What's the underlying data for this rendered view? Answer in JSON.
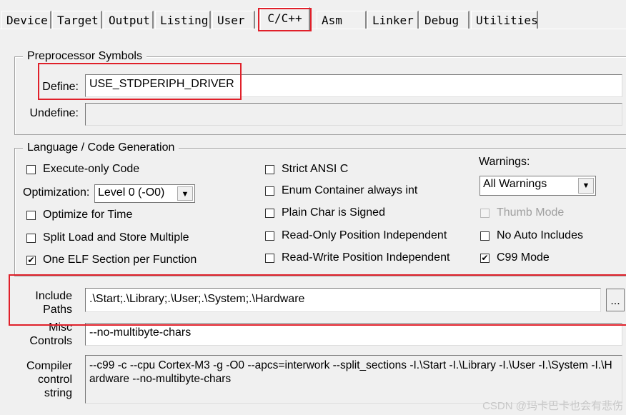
{
  "tabs": [
    {
      "label": "Device"
    },
    {
      "label": "Target"
    },
    {
      "label": "Output"
    },
    {
      "label": "Listing"
    },
    {
      "label": "User"
    },
    {
      "label": "C/C++"
    },
    {
      "label": "Asm"
    },
    {
      "label": "Linker"
    },
    {
      "label": "Debug"
    },
    {
      "label": "Utilities"
    }
  ],
  "active_tab": "C/C++",
  "preprocessor": {
    "title": "Preprocessor Symbols",
    "define_label": "Define:",
    "define_value": "USE_STDPERIPH_DRIVER",
    "undefine_label": "Undefine:",
    "undefine_value": ""
  },
  "language": {
    "title": "Language / Code Generation",
    "execute_only": {
      "label": "Execute-only Code",
      "checked": false
    },
    "optimization_label": "Optimization:",
    "optimization_value": "Level 0 (-O0)",
    "optimize_time": {
      "label": "Optimize for Time",
      "checked": false
    },
    "split_load": {
      "label": "Split Load and Store Multiple",
      "checked": false
    },
    "one_elf": {
      "label": "One ELF Section per Function",
      "checked": true
    },
    "strict_ansi": {
      "label": "Strict ANSI C",
      "checked": false
    },
    "enum_container": {
      "label": "Enum Container always int",
      "checked": false
    },
    "plain_char": {
      "label": "Plain Char is Signed",
      "checked": false
    },
    "ro_pi": {
      "label": "Read-Only Position Independent",
      "checked": false
    },
    "rw_pi": {
      "label": "Read-Write Position Independent",
      "checked": false
    },
    "warnings_label": "Warnings:",
    "warnings_value": "All Warnings",
    "thumb_mode": {
      "label": "Thumb Mode",
      "checked": false,
      "disabled": true
    },
    "no_auto_includes": {
      "label": "No Auto Includes",
      "checked": false
    },
    "c99_mode": {
      "label": "C99 Mode",
      "checked": true
    }
  },
  "include_paths": {
    "label_1": "Include",
    "label_2": "Paths",
    "value": ".\\Start;.\\Library;.\\User;.\\System;.\\Hardware",
    "browse_label": "..."
  },
  "misc_controls": {
    "label_1": "Misc",
    "label_2": "Controls",
    "value": "--no-multibyte-chars"
  },
  "compiler_string": {
    "label_1": "Compiler",
    "label_2": "control",
    "label_3": "string",
    "value": "--c99 -c --cpu Cortex-M3 -g -O0 --apcs=interwork --split_sections -I.\\Start -I.\\Library -I.\\User -I.\\System -I.\\Hardware --no-multibyte-chars"
  },
  "watermark": "CSDN @玛卡巴卡也会有悲伤",
  "highlight_color": "#e0202a"
}
